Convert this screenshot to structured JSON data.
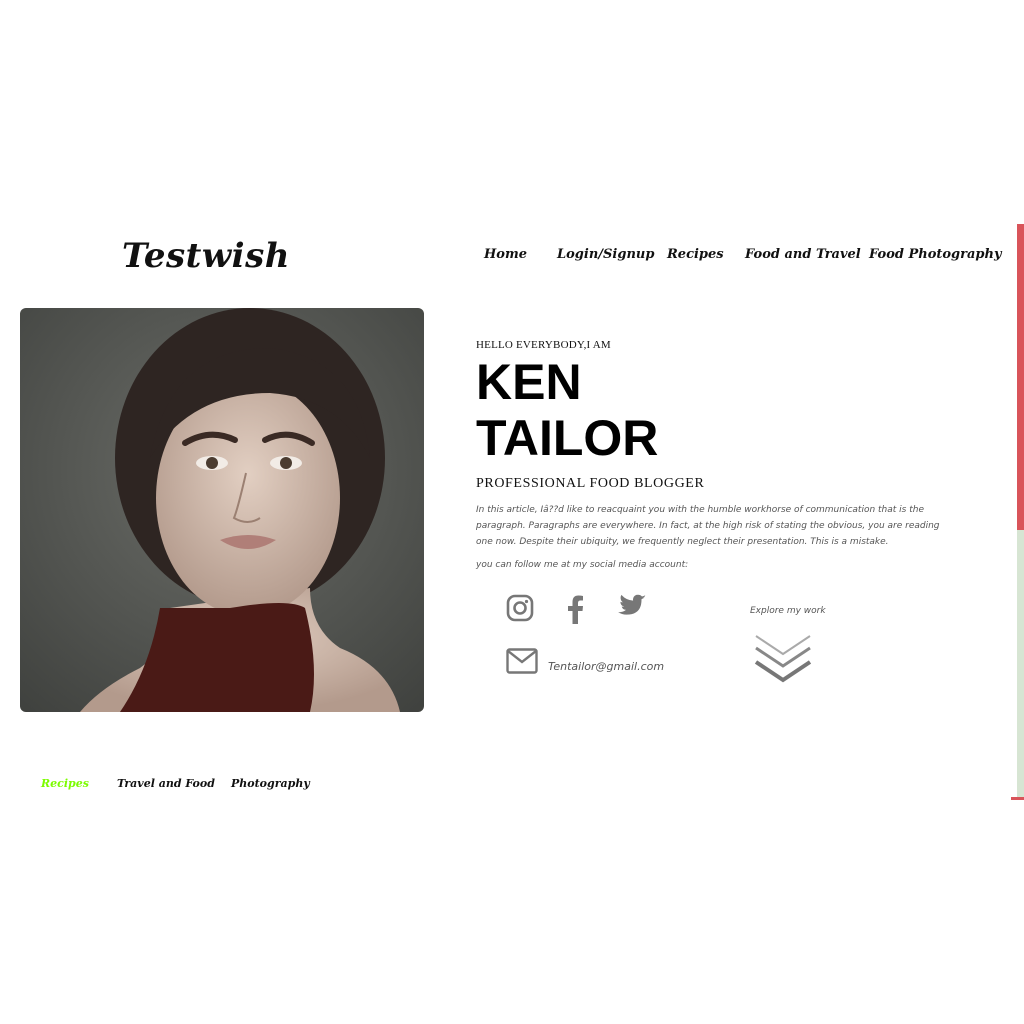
{
  "header": {
    "logo": "Testwish",
    "nav": [
      "Home",
      "Login/Signup",
      "Recipes",
      "Food and Travel",
      "Food Photography"
    ]
  },
  "hero": {
    "greeting": "HELLO EVERYBODY,I AM",
    "name_line1": "KEN",
    "name_line2": "TAILOR",
    "subtitle": "PROFESSIONAL FOOD BLOGGER",
    "paragraph": "In this article, Iâ??d like to reacquaint you with the humble workhorse of communication that is the paragraph. Paragraphs are everywhere. In fact, at the high risk of stating the obvious, you are reading one now. Despite their ubiquity, we frequently neglect their presentation. This is a mistake.",
    "follow_text": "you can follow me at my social media account:",
    "social_icons": [
      "instagram-icon",
      "facebook-icon",
      "twitter-icon"
    ],
    "email": "Tentailor@gmail.com",
    "explore_text": "Explore my work"
  },
  "tabs": {
    "items": [
      "Recipes",
      "Travel and Food",
      "Photography"
    ],
    "active_color": "#7cfc00",
    "color": "#111111"
  },
  "colors": {
    "icon": "#777777",
    "scroll_thumb": "#d9545a",
    "scroll_track": "#d7e5d3"
  }
}
